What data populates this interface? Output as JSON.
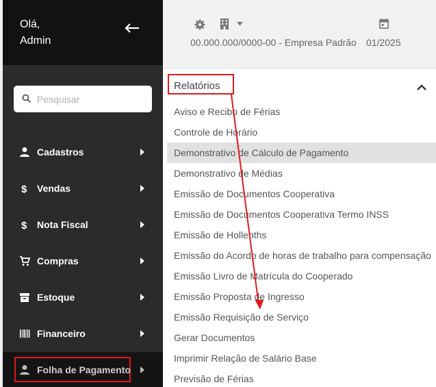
{
  "sidebar": {
    "greeting_line1": "Olá,",
    "greeting_line2": "Admin",
    "back_icon": "arrow-left-icon",
    "search": {
      "placeholder": "Pesquisar",
      "icon": "search-icon"
    },
    "items": [
      {
        "label": "Cadastros",
        "icon": "user-icon"
      },
      {
        "label": "Vendas",
        "icon": "dollar-icon"
      },
      {
        "label": "Nota Fiscal",
        "icon": "dollar-icon"
      },
      {
        "label": "Compras",
        "icon": "cart-icon"
      },
      {
        "label": "Estoque",
        "icon": "archive-icon"
      },
      {
        "label": "Financeiro",
        "icon": "barcode-icon"
      },
      {
        "label": "Folha de Pagamento",
        "icon": "user-icon",
        "active": true
      }
    ]
  },
  "header": {
    "company": "00.000.000/0000-00 - Empresa Padrão",
    "period": "01/2025",
    "icons": [
      "gear-icon",
      "building-icon",
      "caret-down-icon",
      "calendar-icon"
    ]
  },
  "panel": {
    "title": "Relatórios",
    "items": [
      "Aviso e Recibo de Férias",
      "Controle de Horário",
      "Demonstrativo de Cálculo de Pagamento",
      "Demonstrativo de Médias",
      "Emissão de Documentos Cooperativa",
      "Emissão de Documentos Cooperativa Termo INSS",
      "Emissão de Hollenths",
      "Emissão do Acordo de horas de trabalho para compensação",
      "Emissão Livro de Matrícula do Cooperado",
      "Emissão Proposta de Ingresso",
      "Emissão Requisição de Serviço",
      "Gerar Documentos",
      "Imprimir Relação de Salário Base",
      "Previsão de Férias"
    ],
    "selected_index": 2
  },
  "colors": {
    "sidebar_bg": "#2b2b2b",
    "sidebar_header_bg": "#121212",
    "highlight_red": "#e01a1a",
    "selected_row_bg": "#e1e1e1"
  }
}
